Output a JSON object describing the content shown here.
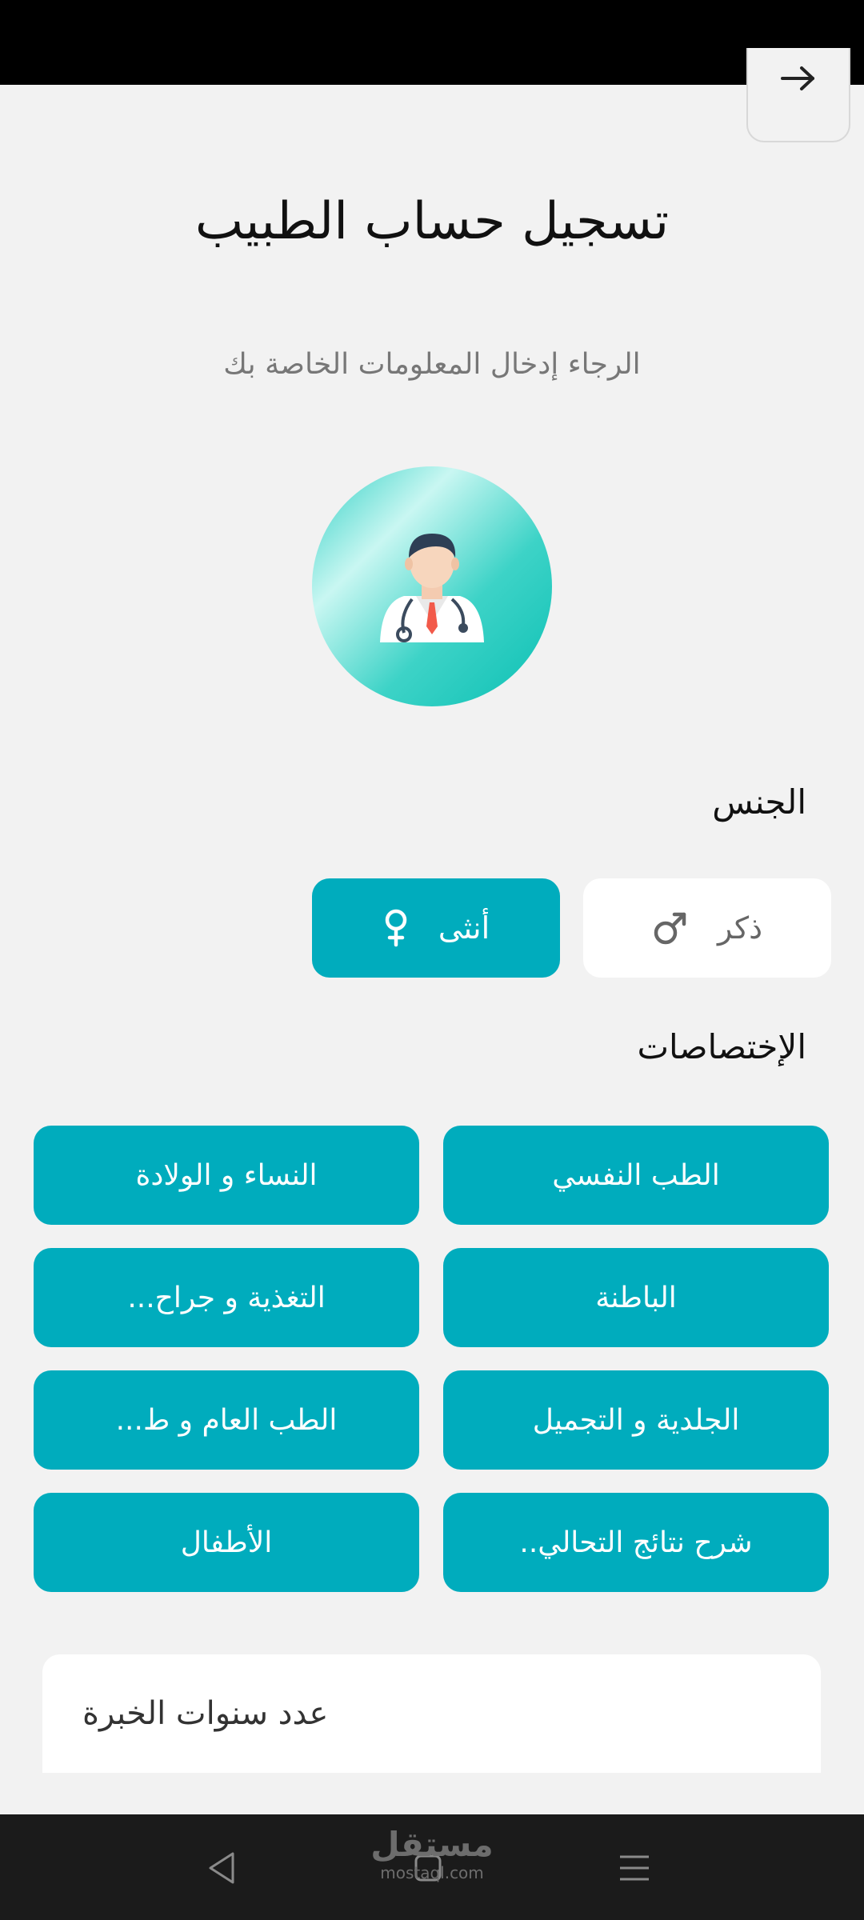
{
  "header": {
    "title": "تسجيل حساب الطبيب",
    "subtitle": "الرجاء إدخال المعلومات الخاصة بك"
  },
  "icons": {
    "back": "arrow-right-icon",
    "avatar": "doctor-icon",
    "male": "male-symbol-icon",
    "female": "female-symbol-icon"
  },
  "gender": {
    "label": "الجنس",
    "male_label": "ذكر",
    "female_label": "أنثى",
    "selected": "أنثى"
  },
  "specialties": {
    "label": "الإختصاصات",
    "items": [
      "الطب النفسي",
      "النساء و الولادة",
      "الباطنة",
      "التغذية و جراح...",
      "الجلدية و التجميل",
      "الطب العام و ط...",
      "شرح نتائج التحالي..",
      "الأطفال"
    ]
  },
  "experience": {
    "placeholder": "عدد سنوات الخبرة"
  },
  "watermark": {
    "arabic": "مستقل",
    "latin": "mostaql.com"
  },
  "colors": {
    "accent": "#00acbd",
    "background": "#f2f2f2",
    "avatar_gradient": "#0cc0b4"
  }
}
